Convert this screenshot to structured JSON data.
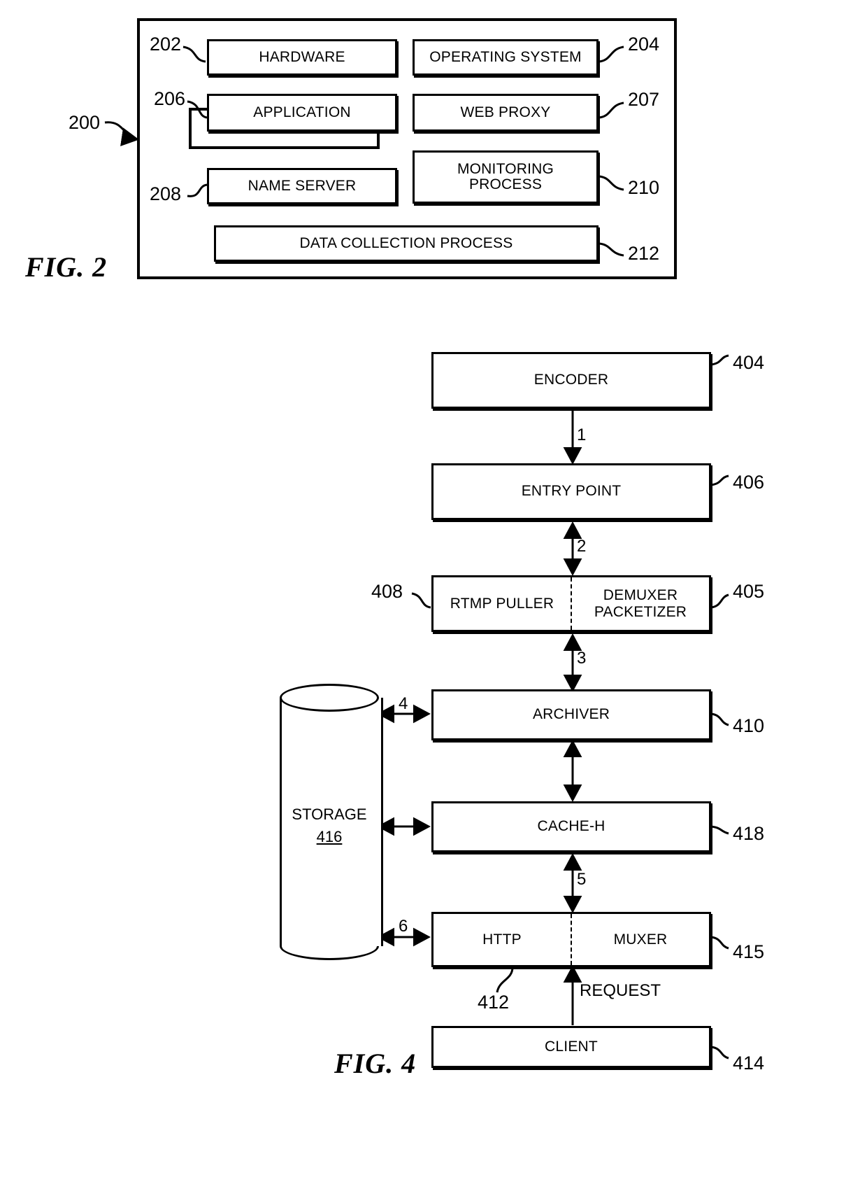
{
  "figures": [
    {
      "id": "fig2",
      "label": "FIG. 2",
      "system_ref": "200",
      "blocks": [
        {
          "ref": "202",
          "label": "HARDWARE"
        },
        {
          "ref": "204",
          "label": "OPERATING SYSTEM"
        },
        {
          "ref": "206",
          "label": "APPLICATION"
        },
        {
          "ref": "207",
          "label": "WEB PROXY"
        },
        {
          "ref": "208",
          "label": "NAME SERVER"
        },
        {
          "ref": "210",
          "label": "MONITORING PROCESS",
          "line1": "MONITORING",
          "line2": "PROCESS"
        },
        {
          "ref": "212",
          "label": "DATA COLLECTION PROCESS"
        }
      ]
    },
    {
      "id": "fig4",
      "label": "FIG. 4",
      "blocks": [
        {
          "ref": "404",
          "label": "ENCODER"
        },
        {
          "ref": "406",
          "label": "ENTRY POINT"
        },
        {
          "ref": "408",
          "label": "RTMP PULLER"
        },
        {
          "ref": "405",
          "label": "DEMUXER PACKETIZER",
          "line1": "DEMUXER",
          "line2": "PACKETIZER"
        },
        {
          "ref": "410",
          "label": "ARCHIVER"
        },
        {
          "ref": "418",
          "label": "CACHE-H"
        },
        {
          "ref": "412",
          "label": "HTTP"
        },
        {
          "ref": "415",
          "label": "MUXER"
        },
        {
          "ref": "414",
          "label": "CLIENT"
        },
        {
          "ref": "416",
          "label": "STORAGE"
        }
      ],
      "step_numbers": [
        "1",
        "2",
        "3",
        "4",
        "5",
        "6"
      ],
      "request_label": "REQUEST"
    }
  ],
  "fig2": {
    "label": "FIG. 2",
    "ref_200": "200",
    "ref_202": "202",
    "ref_204": "204",
    "ref_206": "206",
    "ref_207": "207",
    "ref_208": "208",
    "ref_210": "210",
    "ref_212": "212",
    "hardware": "HARDWARE",
    "operating_system": "OPERATING SYSTEM",
    "application": "APPLICATION",
    "web_proxy": "WEB PROXY",
    "name_server": "NAME SERVER",
    "monitoring_l1": "MONITORING",
    "monitoring_l2": "PROCESS",
    "data_collection": "DATA COLLECTION PROCESS"
  },
  "fig4": {
    "label": "FIG. 4",
    "encoder": "ENCODER",
    "entry_point": "ENTRY POINT",
    "rtmp_puller": "RTMP PULLER",
    "demuxer_l1": "DEMUXER",
    "demuxer_l2": "PACKETIZER",
    "archiver": "ARCHIVER",
    "cache_h": "CACHE-H",
    "http": "HTTP",
    "muxer": "MUXER",
    "client": "CLIENT",
    "storage": "STORAGE",
    "storage_num": "416",
    "request": "REQUEST",
    "ref_404": "404",
    "ref_406": "406",
    "ref_408": "408",
    "ref_405": "405",
    "ref_410": "410",
    "ref_418": "418",
    "ref_412": "412",
    "ref_415": "415",
    "ref_414": "414",
    "step_1": "1",
    "step_2": "2",
    "step_3": "3",
    "step_4": "4",
    "step_5": "5",
    "step_6": "6"
  }
}
